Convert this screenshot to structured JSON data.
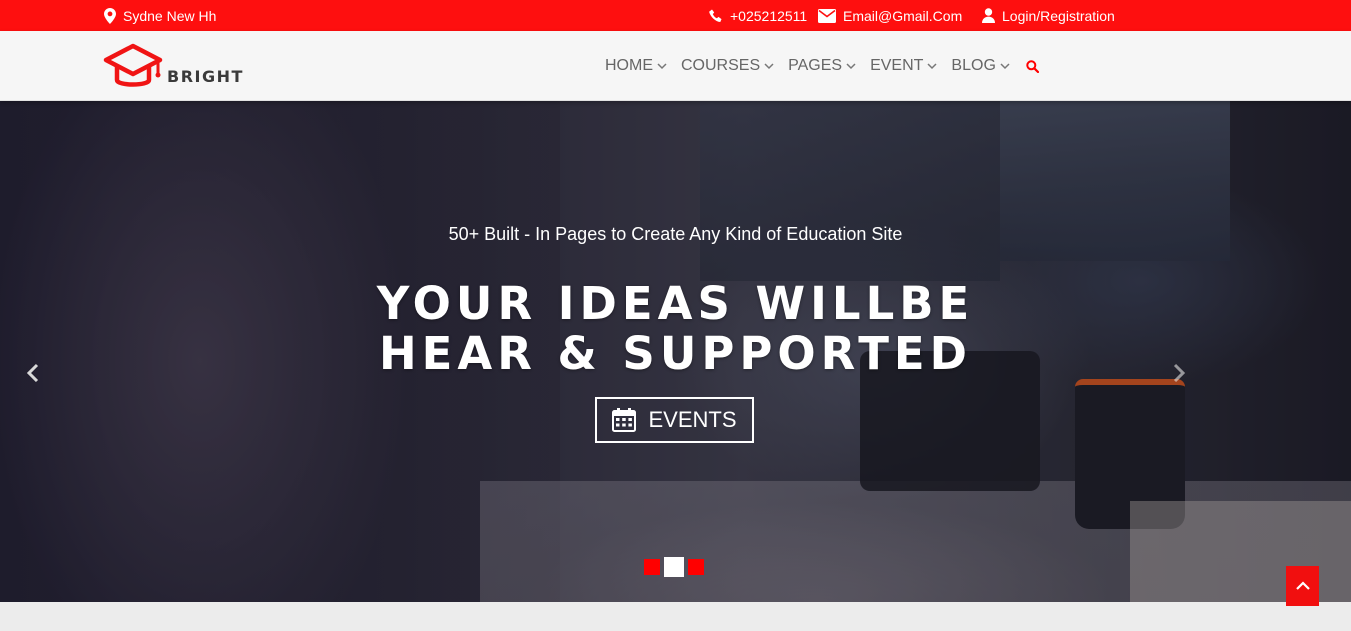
{
  "topbar": {
    "location": "Sydne New Hh",
    "phone": "+025212511",
    "email": "Email@Gmail.Com",
    "login": "Login/Registration",
    "icons": [
      "map-marker-icon",
      "phone-icon",
      "envelope-icon",
      "user-icon"
    ]
  },
  "header": {
    "logo_text": "BRIGHT",
    "nav": [
      {
        "label": "HOME"
      },
      {
        "label": "COURSES"
      },
      {
        "label": "PAGES"
      },
      {
        "label": "EVENT"
      },
      {
        "label": "BLOG"
      }
    ],
    "search_icon": "search-icon"
  },
  "hero": {
    "subtitle": "50+ Built - In Pages to Create Any Kind of Education Site",
    "title_line1": "YOUR IDEAS WILLBE",
    "title_line2": "HEAR & SUPPORTED",
    "button_label": "EVENTS",
    "button_icon": "calendar-icon",
    "slides_count": 3,
    "active_slide": 2
  },
  "colors": {
    "brand_red": "#fe0f0f",
    "header_bg": "#f6f6f6",
    "nav_text": "#666666"
  }
}
